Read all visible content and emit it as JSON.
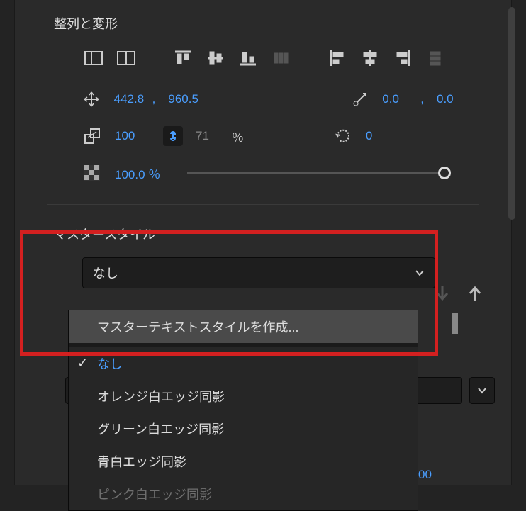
{
  "align": {
    "title": "整列と変形",
    "position_x": "442.8",
    "position_y": "960.5",
    "anchor_x": "0.0",
    "anchor_y": "0.0",
    "scale_w": "100",
    "scale_h": "71",
    "percent": "％",
    "rotation": "0",
    "opacity": "100.0 ％"
  },
  "master_style": {
    "title": "マスタースタイル",
    "selected": "なし",
    "menu": {
      "create": "マスターテキストスタイルを作成...",
      "none": "なし",
      "orange": "オレンジ白エッジ同影",
      "green": "グリーン白エッジ同影",
      "bluewhite": "青白エッジ同影",
      "pink": "ピンク白エッジ同影"
    }
  },
  "stray": "00"
}
